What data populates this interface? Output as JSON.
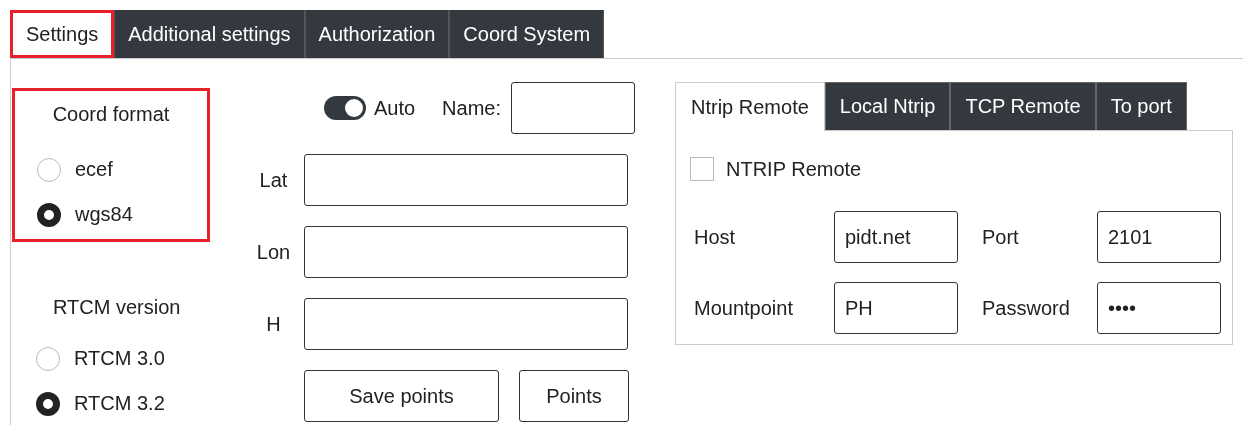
{
  "tabs": [
    {
      "label": "Settings",
      "selected": true,
      "highlighted": true
    },
    {
      "label": "Additional settings",
      "selected": false,
      "highlighted": false
    },
    {
      "label": "Authorization",
      "selected": false,
      "highlighted": false
    },
    {
      "label": "Coord System",
      "selected": false,
      "highlighted": false
    }
  ],
  "coord_format": {
    "title": "Coord format",
    "highlighted": true,
    "options": [
      {
        "label": "ecef",
        "selected": false
      },
      {
        "label": "wgs84",
        "selected": true
      }
    ]
  },
  "rtcm_version": {
    "title": "RTCM version",
    "options": [
      {
        "label": "RTCM 3.0",
        "selected": false
      },
      {
        "label": "RTCM 3.2",
        "selected": true
      }
    ]
  },
  "auto_toggle": {
    "label": "Auto",
    "on": true
  },
  "name_field": {
    "label": "Name:"
  },
  "coordinates": [
    {
      "label": "Lat"
    },
    {
      "label": "Lon"
    },
    {
      "label": "H"
    }
  ],
  "buttons": [
    "Save points",
    "Points"
  ],
  "connection": {
    "tabs": [
      {
        "label": "Ntrip Remote",
        "selected": true
      },
      {
        "label": "Local Ntrip",
        "selected": false
      },
      {
        "label": "TCP Remote",
        "selected": false
      },
      {
        "label": "To port",
        "selected": false
      }
    ],
    "checkbox": {
      "label": "NTRIP Remote",
      "checked": false
    },
    "fields": [
      {
        "label": "Host",
        "value": "pidt.net"
      },
      {
        "label": "Port",
        "value": "2101"
      },
      {
        "label": "Mountpoint",
        "value": "PH"
      },
      {
        "label": "Password",
        "value": "••••"
      }
    ]
  }
}
